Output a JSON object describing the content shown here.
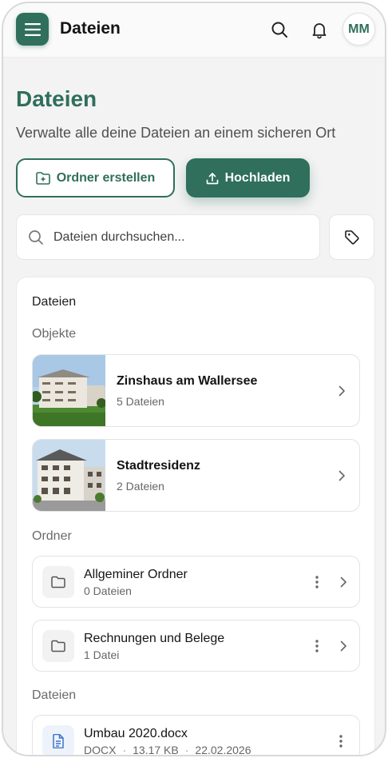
{
  "topbar": {
    "title": "Dateien",
    "avatar_initials": "MM",
    "icons": [
      "menu-icon",
      "search-icon",
      "bell-icon"
    ]
  },
  "header": {
    "title": "Dateien",
    "subtitle": "Verwalte alle deine Dateien an einem sicheren Ort"
  },
  "actions": {
    "create_folder_label": "Ordner erstellen",
    "upload_label": "Hochladen"
  },
  "search": {
    "placeholder": "Dateien durchsuchen..."
  },
  "card": {
    "title": "Dateien",
    "objects_label": "Objekte",
    "folders_label": "Ordner",
    "files_label": "Dateien",
    "objects": [
      {
        "name": "Zinshaus am Wallersee",
        "count": "5 Dateien"
      },
      {
        "name": "Stadtresidenz",
        "count": "2 Dateien"
      }
    ],
    "folders": [
      {
        "name": "Allgeminer Ordner",
        "count": "0 Dateien"
      },
      {
        "name": "Rechnungen und Belege",
        "count": "1 Datei"
      }
    ],
    "files": [
      {
        "name": "Umbau 2020.docx",
        "type": "DOCX",
        "size": "13.17 KB",
        "date": "22.02.2026"
      }
    ]
  },
  "colors": {
    "accent": "#2f6f5c",
    "background": "#f3f3f3"
  }
}
